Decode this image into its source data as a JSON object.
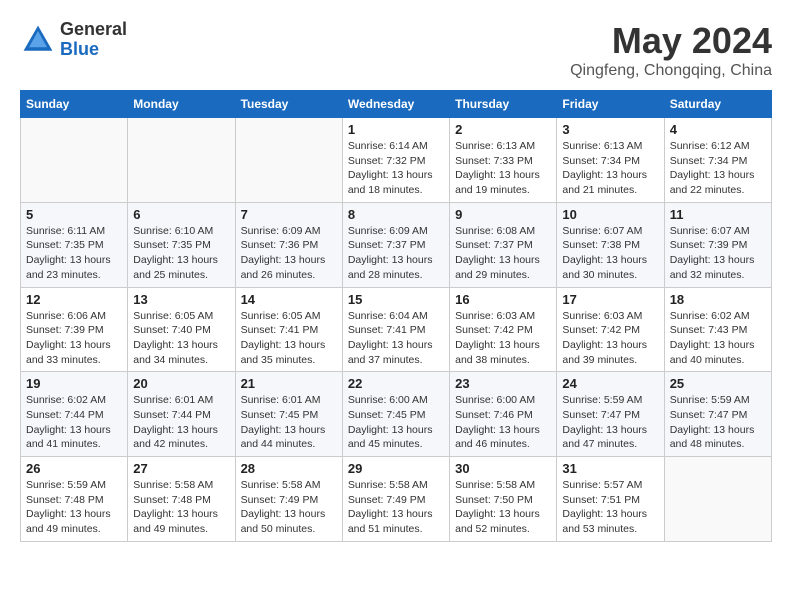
{
  "header": {
    "logo_general": "General",
    "logo_blue": "Blue",
    "month_title": "May 2024",
    "location": "Qingfeng, Chongqing, China"
  },
  "weekdays": [
    "Sunday",
    "Monday",
    "Tuesday",
    "Wednesday",
    "Thursday",
    "Friday",
    "Saturday"
  ],
  "weeks": [
    [
      {
        "day": "",
        "info": ""
      },
      {
        "day": "",
        "info": ""
      },
      {
        "day": "",
        "info": ""
      },
      {
        "day": "1",
        "info": "Sunrise: 6:14 AM\nSunset: 7:32 PM\nDaylight: 13 hours\nand 18 minutes."
      },
      {
        "day": "2",
        "info": "Sunrise: 6:13 AM\nSunset: 7:33 PM\nDaylight: 13 hours\nand 19 minutes."
      },
      {
        "day": "3",
        "info": "Sunrise: 6:13 AM\nSunset: 7:34 PM\nDaylight: 13 hours\nand 21 minutes."
      },
      {
        "day": "4",
        "info": "Sunrise: 6:12 AM\nSunset: 7:34 PM\nDaylight: 13 hours\nand 22 minutes."
      }
    ],
    [
      {
        "day": "5",
        "info": "Sunrise: 6:11 AM\nSunset: 7:35 PM\nDaylight: 13 hours\nand 23 minutes."
      },
      {
        "day": "6",
        "info": "Sunrise: 6:10 AM\nSunset: 7:35 PM\nDaylight: 13 hours\nand 25 minutes."
      },
      {
        "day": "7",
        "info": "Sunrise: 6:09 AM\nSunset: 7:36 PM\nDaylight: 13 hours\nand 26 minutes."
      },
      {
        "day": "8",
        "info": "Sunrise: 6:09 AM\nSunset: 7:37 PM\nDaylight: 13 hours\nand 28 minutes."
      },
      {
        "day": "9",
        "info": "Sunrise: 6:08 AM\nSunset: 7:37 PM\nDaylight: 13 hours\nand 29 minutes."
      },
      {
        "day": "10",
        "info": "Sunrise: 6:07 AM\nSunset: 7:38 PM\nDaylight: 13 hours\nand 30 minutes."
      },
      {
        "day": "11",
        "info": "Sunrise: 6:07 AM\nSunset: 7:39 PM\nDaylight: 13 hours\nand 32 minutes."
      }
    ],
    [
      {
        "day": "12",
        "info": "Sunrise: 6:06 AM\nSunset: 7:39 PM\nDaylight: 13 hours\nand 33 minutes."
      },
      {
        "day": "13",
        "info": "Sunrise: 6:05 AM\nSunset: 7:40 PM\nDaylight: 13 hours\nand 34 minutes."
      },
      {
        "day": "14",
        "info": "Sunrise: 6:05 AM\nSunset: 7:41 PM\nDaylight: 13 hours\nand 35 minutes."
      },
      {
        "day": "15",
        "info": "Sunrise: 6:04 AM\nSunset: 7:41 PM\nDaylight: 13 hours\nand 37 minutes."
      },
      {
        "day": "16",
        "info": "Sunrise: 6:03 AM\nSunset: 7:42 PM\nDaylight: 13 hours\nand 38 minutes."
      },
      {
        "day": "17",
        "info": "Sunrise: 6:03 AM\nSunset: 7:42 PM\nDaylight: 13 hours\nand 39 minutes."
      },
      {
        "day": "18",
        "info": "Sunrise: 6:02 AM\nSunset: 7:43 PM\nDaylight: 13 hours\nand 40 minutes."
      }
    ],
    [
      {
        "day": "19",
        "info": "Sunrise: 6:02 AM\nSunset: 7:44 PM\nDaylight: 13 hours\nand 41 minutes."
      },
      {
        "day": "20",
        "info": "Sunrise: 6:01 AM\nSunset: 7:44 PM\nDaylight: 13 hours\nand 42 minutes."
      },
      {
        "day": "21",
        "info": "Sunrise: 6:01 AM\nSunset: 7:45 PM\nDaylight: 13 hours\nand 44 minutes."
      },
      {
        "day": "22",
        "info": "Sunrise: 6:00 AM\nSunset: 7:45 PM\nDaylight: 13 hours\nand 45 minutes."
      },
      {
        "day": "23",
        "info": "Sunrise: 6:00 AM\nSunset: 7:46 PM\nDaylight: 13 hours\nand 46 minutes."
      },
      {
        "day": "24",
        "info": "Sunrise: 5:59 AM\nSunset: 7:47 PM\nDaylight: 13 hours\nand 47 minutes."
      },
      {
        "day": "25",
        "info": "Sunrise: 5:59 AM\nSunset: 7:47 PM\nDaylight: 13 hours\nand 48 minutes."
      }
    ],
    [
      {
        "day": "26",
        "info": "Sunrise: 5:59 AM\nSunset: 7:48 PM\nDaylight: 13 hours\nand 49 minutes."
      },
      {
        "day": "27",
        "info": "Sunrise: 5:58 AM\nSunset: 7:48 PM\nDaylight: 13 hours\nand 49 minutes."
      },
      {
        "day": "28",
        "info": "Sunrise: 5:58 AM\nSunset: 7:49 PM\nDaylight: 13 hours\nand 50 minutes."
      },
      {
        "day": "29",
        "info": "Sunrise: 5:58 AM\nSunset: 7:49 PM\nDaylight: 13 hours\nand 51 minutes."
      },
      {
        "day": "30",
        "info": "Sunrise: 5:58 AM\nSunset: 7:50 PM\nDaylight: 13 hours\nand 52 minutes."
      },
      {
        "day": "31",
        "info": "Sunrise: 5:57 AM\nSunset: 7:51 PM\nDaylight: 13 hours\nand 53 minutes."
      },
      {
        "day": "",
        "info": ""
      }
    ]
  ]
}
